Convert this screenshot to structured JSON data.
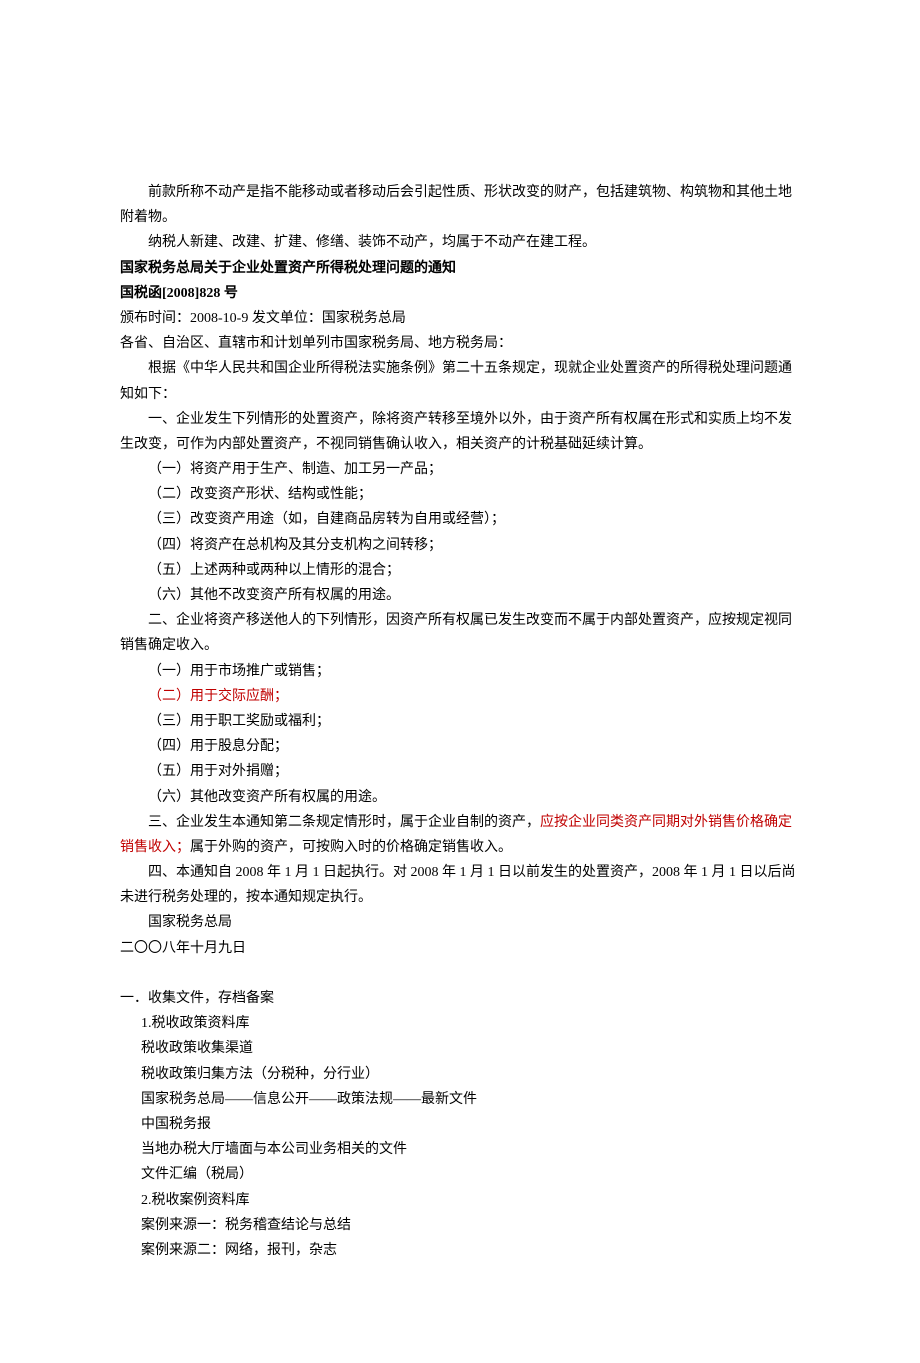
{
  "intro": {
    "p1": "前款所称不动产是指不能移动或者移动后会引起性质、形状改变的财产，包括建筑物、构筑物和其他土地附着物。",
    "p2": "纳税人新建、改建、扩建、修缮、装饰不动产，均属于不动产在建工程。"
  },
  "notice": {
    "title": "国家税务总局关于企业处置资产所得税处理问题的通知",
    "docno": "国税函[2008]828 号",
    "meta": "颁布时间：2008-10-9 发文单位：国家税务总局",
    "addressee": "各省、自治区、直辖市和计划单列市国家税务局、地方税务局：",
    "p1": "根据《中华人民共和国企业所得税法实施条例》第二十五条规定，现就企业处置资产的所得税处理问题通知如下：",
    "s1": {
      "head": "一、企业发生下列情形的处置资产，除将资产转移至境外以外，由于资产所有权属在形式和实质上均不发生改变，可作为内部处置资产，不视同销售确认收入，相关资产的计税基础延续计算。",
      "i1": "（一）将资产用于生产、制造、加工另一产品；",
      "i2": "（二）改变资产形状、结构或性能；",
      "i3": "（三）改变资产用途（如，自建商品房转为自用或经营）；",
      "i4": "（四）将资产在总机构及其分支机构之间转移；",
      "i5": "（五）上述两种或两种以上情形的混合；",
      "i6": "（六）其他不改变资产所有权属的用途。"
    },
    "s2": {
      "head": "二、企业将资产移送他人的下列情形，因资产所有权属已发生改变而不属于内部处置资产，应按规定视同销售确定收入。",
      "i1": "（一）用于市场推广或销售；",
      "i2": "（二）用于交际应酬；",
      "i3": "（三）用于职工奖励或福利；",
      "i4": "（四）用于股息分配；",
      "i5": "（五）用于对外捐赠；",
      "i6": "（六）其他改变资产所有权属的用途。"
    },
    "s3": {
      "pre": "三、企业发生本通知第二条规定情形时，属于企业自制的资产，",
      "red": "应按企业同类资产同期对外销售价格确定销售收入；",
      "post": "属于外购的资产，可按购入时的价格确定销售收入。"
    },
    "s4": "四、本通知自 2008 年 1 月 1 日起执行。对 2008 年 1 月 1 日以前发生的处置资产，2008 年 1 月 1 日以后尚未进行税务处理的，按本通知规定执行。",
    "sign": "国家税务总局",
    "date": "二〇〇八年十月九日"
  },
  "outline": {
    "h1": "一．收集文件，存档备案",
    "i1": "1.税收政策资料库",
    "i2": "税收政策收集渠道",
    "i3": "税收政策归集方法（分税种，分行业）",
    "i4": "国家税务总局——信息公开——政策法规——最新文件",
    "i5": "中国税务报",
    "i6": "当地办税大厅墙面与本公司业务相关的文件",
    "i7": "文件汇编（税局）",
    "i8": "2.税收案例资料库",
    "i9": "案例来源一：税务稽查结论与总结",
    "i10": "案例来源二：网络，报刊，杂志"
  }
}
